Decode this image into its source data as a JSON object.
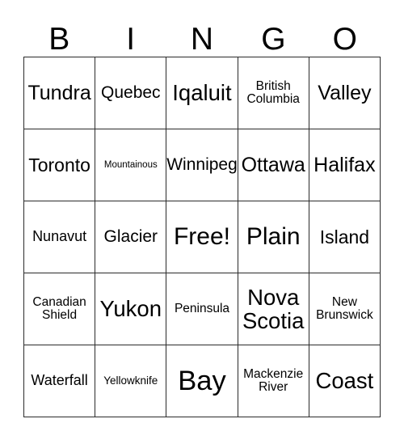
{
  "card": {
    "title": "Bingo Card",
    "header_letters": [
      "B",
      "I",
      "N",
      "G",
      "O"
    ],
    "free_space": "Free!",
    "colors": {
      "background": "#ffffff",
      "text": "#000000",
      "border": "#2b2b2b"
    },
    "columns": [
      {
        "letter": "B",
        "cells": [
          {
            "text": "Tundra",
            "size": "fs-3xl",
            "lines": 1
          },
          {
            "text": "Toronto",
            "size": "fs-2xl",
            "lines": 1
          },
          {
            "text": "Nunavut",
            "size": "fs-lg",
            "lines": 1
          },
          {
            "text": "Canadian\nShield",
            "size": "fs-md",
            "lines": 2
          },
          {
            "text": "Waterfall",
            "size": "fs-lg",
            "lines": 1
          }
        ]
      },
      {
        "letter": "I",
        "cells": [
          {
            "text": "Quebec",
            "size": "fs-xl",
            "lines": 1
          },
          {
            "text": "Mountainous",
            "size": "fs-xs",
            "lines": 1
          },
          {
            "text": "Glacier",
            "size": "fs-xl",
            "lines": 1
          },
          {
            "text": "Yukon",
            "size": "fs-4xl",
            "lines": 1
          },
          {
            "text": "Yellowknife",
            "size": "fs-sm",
            "lines": 1
          }
        ]
      },
      {
        "letter": "N",
        "cells": [
          {
            "text": "Iqaluit",
            "size": "fs-4xl",
            "lines": 1
          },
          {
            "text": "Winnipeg",
            "size": "fs-xl",
            "lines": 1
          },
          {
            "text": "Free!",
            "size": "fs-5xl",
            "lines": 1
          },
          {
            "text": "Peninsula",
            "size": "fs-md",
            "lines": 1
          },
          {
            "text": "Bay",
            "size": "fs-6xl",
            "lines": 1
          }
        ]
      },
      {
        "letter": "G",
        "cells": [
          {
            "text": "British\nColumbia",
            "size": "fs-md",
            "lines": 2
          },
          {
            "text": "Ottawa",
            "size": "fs-3xl",
            "lines": 1
          },
          {
            "text": "Plain",
            "size": "fs-5xl",
            "lines": 1
          },
          {
            "text": "Nova\nScotia",
            "size": "fs-4xl",
            "lines": 2
          },
          {
            "text": "Mackenzie\nRiver",
            "size": "fs-md",
            "lines": 2
          }
        ]
      },
      {
        "letter": "O",
        "cells": [
          {
            "text": "Valley",
            "size": "fs-3xl",
            "lines": 1
          },
          {
            "text": "Halifax",
            "size": "fs-3xl",
            "lines": 1
          },
          {
            "text": "Island",
            "size": "fs-2xl",
            "lines": 1
          },
          {
            "text": "New\nBrunswick",
            "size": "fs-md",
            "lines": 2
          },
          {
            "text": "Coast",
            "size": "fs-4xl",
            "lines": 1
          }
        ]
      }
    ]
  }
}
